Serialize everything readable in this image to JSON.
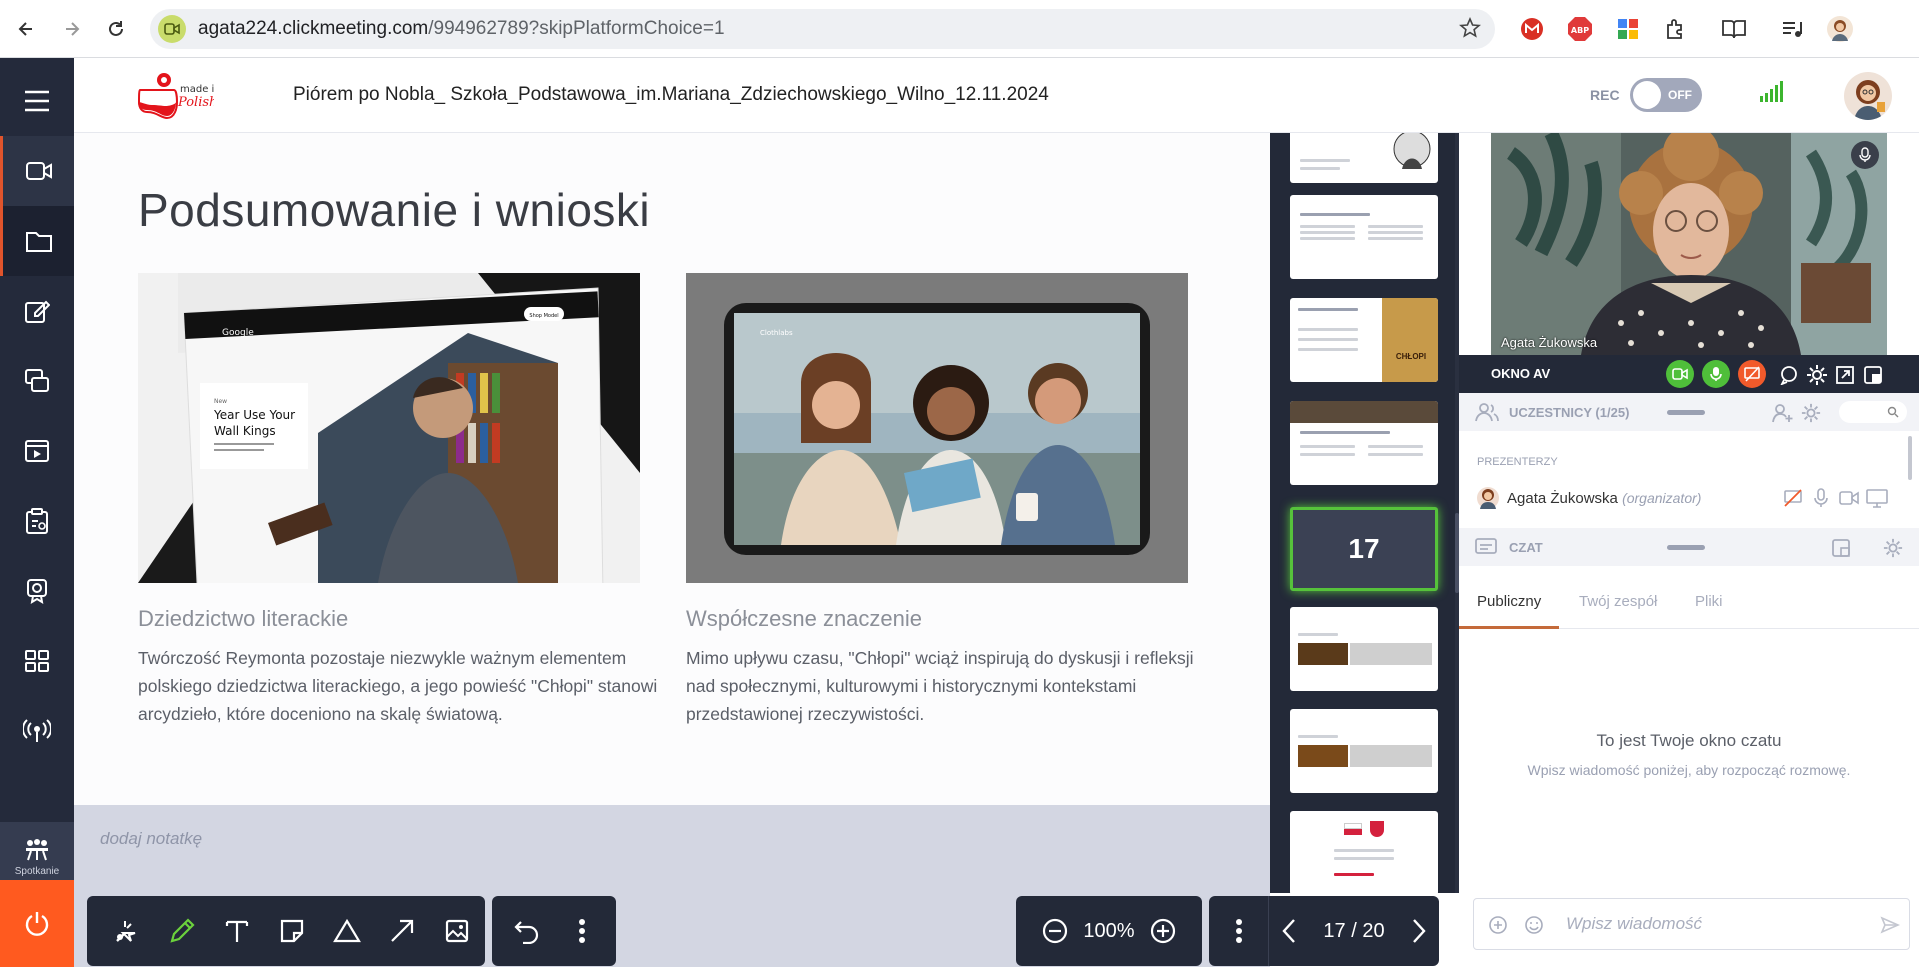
{
  "browser": {
    "url_host": "agata224.clickmeeting.com",
    "url_path": "/994962789?skipPlatformChoice=1"
  },
  "sidebar": {
    "meeting_label": "Spotkanie"
  },
  "header": {
    "title": "Piórem po Nobla_ Szkoła_Podstawowa_im.Mariana_Zdziechowskiego_Wilno_12.11.2024",
    "rec_label": "REC",
    "rec_state": "OFF"
  },
  "slide": {
    "title": "Podsumowanie i wnioski",
    "image1_text": "Year Use Your Wall Kings",
    "image1_brand": "Google",
    "image1_button": "Shop Model",
    "left_heading": "Dziedzictwo literackie",
    "left_body": "Twórczość Reymonta pozostaje niezwykle ważnym elementem polskiego dziedzictwa literackiego, a jego powieść \"Chłopi\" stanowi arcydzieło, które doceniono na skalę światową.",
    "right_heading": "Współczesne znaczenie",
    "right_body": "Mimo upływu czasu, \"Chłopi\" wciąż inspirują do dyskusji i refleksji nad społecznymi, kulturowymi i historycznymi kontekstami przedstawionej rzeczywistości."
  },
  "notes": {
    "placeholder": "dodaj notatkę"
  },
  "zoom": {
    "value": "100%"
  },
  "pager": {
    "value": "17 / 20"
  },
  "thumbnails": {
    "current_number": "17",
    "chlopi_label": "CHŁOPI"
  },
  "video": {
    "name": "Agata Żukowska"
  },
  "av": {
    "label": "OKNO AV"
  },
  "participants": {
    "header": "UCZESTNICY (1/25)",
    "presenters_label": "PREZENTERZY",
    "presenter_name": "Agata Żukowska",
    "presenter_role": "(organizator)"
  },
  "chat": {
    "header": "CZAT",
    "tabs": [
      "Publiczny",
      "Twój zespół",
      "Pliki"
    ],
    "empty_title": "To jest Twoje okno czatu",
    "empty_sub": "Wpisz wiadomość poniżej, aby rozpocząć rozmowę.",
    "input_placeholder": "Wpisz wiadomość"
  },
  "colors": {
    "sidebar_bg": "#242a3b",
    "accent_orange": "#ff5a1f",
    "active_green": "#56c23b",
    "notes_bg": "#d3d6e2"
  }
}
